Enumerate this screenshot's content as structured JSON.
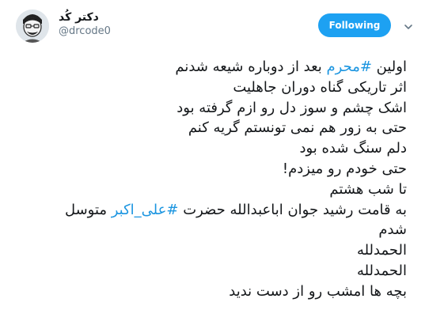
{
  "tweet": {
    "author": {
      "display_name": "دکتر کُد",
      "handle": "@drcode0"
    },
    "follow_label": "Following",
    "accent_color": "#1da1f2",
    "hashtag_color": "#1b95e0",
    "icons": {
      "avatar": "cartoon-avatar-icon",
      "menu": "chevron-down-icon"
    },
    "lines": {
      "l1_before": "اولین ",
      "l1_tag": "#محرم",
      "l1_after": " بعد از دوباره شیعه شدنم",
      "l2": "اثر تاریکی گناه دوران جاهلیت",
      "l3": "اشک چشم و سوز دل رو ازم گرفته بود",
      "l4": "حتی به زور هم نمی تونستم گریه کنم",
      "l5": "دلم سنگ شده بود",
      "l6": "حتی خودم رو میزدم!",
      "l7": "تا شب هشتم",
      "l8_before": "به قامت رشید جوان اباعبدالله حضرت ",
      "l8_tag": "#علی_اکبر",
      "l8_after": " متوسل",
      "l9": "شدم",
      "l10": "الحمدلله",
      "l11": "الحمدلله",
      "l12": "بچه ها امشب رو از دست ندید"
    }
  }
}
